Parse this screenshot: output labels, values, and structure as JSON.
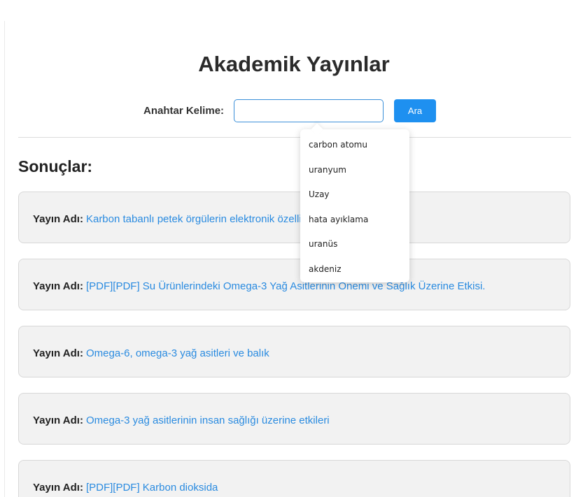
{
  "title": "Akademik Yayınlar",
  "search": {
    "label": "Anahtar Kelime:",
    "value": "",
    "button_label": "Ara"
  },
  "results_heading": "Sonuçlar:",
  "results": [
    {
      "label": "Yayın Adı:",
      "title": "Karbon tabanlı petek örgülerin elektronik özellikleri"
    },
    {
      "label": "Yayın Adı:",
      "title": "[PDF][PDF] Su Ürünlerindeki Omega-3 Yağ Asitlerinin Önemi ve Sağlık Üzerine Etkisi."
    },
    {
      "label": "Yayın Adı:",
      "title": "Omega-6, omega-3 yağ asitleri ve balık"
    },
    {
      "label": "Yayın Adı:",
      "title": "Omega-3 yağ asitlerinin insan sağlığı üzerine etkileri"
    },
    {
      "label": "Yayın Adı:",
      "title": "[PDF][PDF] Karbon dioksida"
    }
  ],
  "autocomplete": {
    "items": [
      "carbon atomu",
      "uranyum",
      "Uzay",
      "hata ayıklama",
      "uranüs",
      "akdeniz"
    ]
  },
  "colors": {
    "accent": "#1e90f0",
    "link": "#2a8be0",
    "card_background": "#f2f2f2"
  }
}
